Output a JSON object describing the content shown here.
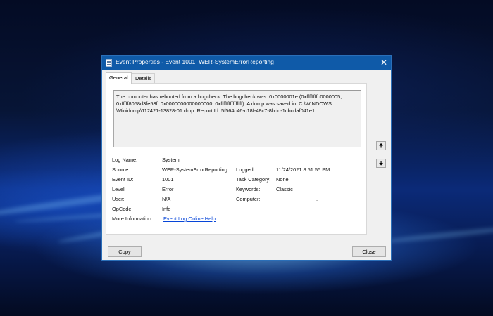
{
  "window": {
    "title": "Event Properties - Event 1001, WER-SystemErrorReporting",
    "close_glyph": "✕"
  },
  "tabs": [
    {
      "label": "General",
      "active": true
    },
    {
      "label": "Details",
      "active": false
    }
  ],
  "description": "The computer has rebooted from a bugcheck.  The bugcheck was: 0x0000001e (0xffffffffc0000005,\n0xfffff8058d3fe53f, 0x0000000000000000, 0xffffffffffffffff). A dump was saved in: C:\\WINDOWS\n\\Minidump\\112421-13828-01.dmp. Report Id: 5f564c46-c18f-48c7-8bdd-1cbcdaf041e1.",
  "fields": {
    "log_name": {
      "label": "Log Name:",
      "value": "System"
    },
    "source": {
      "label": "Source:",
      "value": "WER-SystemErrorReporting"
    },
    "logged": {
      "label": "Logged:",
      "value": "11/24/2021 8:51:55 PM"
    },
    "event_id": {
      "label": "Event ID:",
      "value": "1001"
    },
    "task_category": {
      "label": "Task Category:",
      "value": "None"
    },
    "level": {
      "label": "Level:",
      "value": "Error"
    },
    "keywords": {
      "label": "Keywords:",
      "value": "Classic"
    },
    "user": {
      "label": "User:",
      "value": "N/A"
    },
    "computer": {
      "label": "Computer:",
      "value": "."
    },
    "opcode": {
      "label": "OpCode:",
      "value": "Info"
    },
    "more_info": {
      "label": "More Information:",
      "value": "Event Log Online Help"
    }
  },
  "nav": {
    "up_glyph": "🠉",
    "down_glyph": "🠋"
  },
  "buttons": {
    "copy": "Copy",
    "close": "Close"
  },
  "colors": {
    "titlebar": "#0f5aa8",
    "link": "#0645d8"
  }
}
